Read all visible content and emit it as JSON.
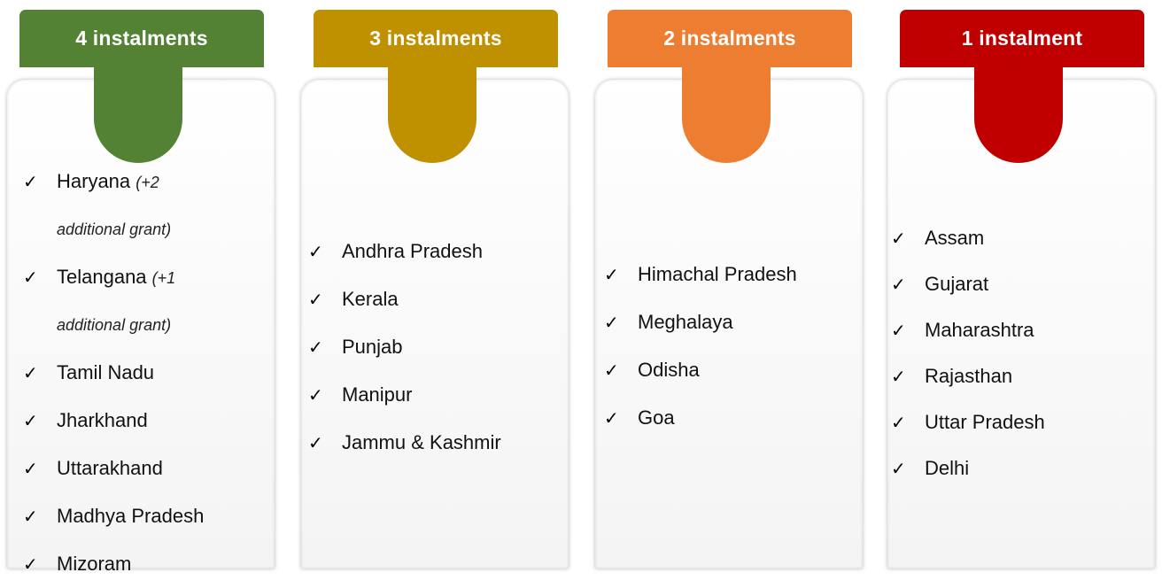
{
  "colors": {
    "green": "#548235",
    "gold": "#BF9000",
    "orange": "#ED7D31",
    "red": "#C00000"
  },
  "columns": [
    {
      "title": "4 instalments",
      "color": "#548235",
      "items": [
        {
          "label": "Haryana",
          "note_part1": "(+2",
          "note_part2": "additional grant)"
        },
        {
          "label": "Telangana",
          "note_part1": "(+1",
          "note_part2": "additional grant)"
        },
        {
          "label": "Tamil Nadu"
        },
        {
          "label": "Jharkhand"
        },
        {
          "label": "Uttarakhand"
        },
        {
          "label": "Madhya Pradesh"
        },
        {
          "label": "Mizoram"
        }
      ]
    },
    {
      "title": "3 instalments",
      "color": "#BF9000",
      "items": [
        {
          "label": "Andhra Pradesh"
        },
        {
          "label": "Kerala"
        },
        {
          "label": "Punjab"
        },
        {
          "label": "Manipur"
        },
        {
          "label": "Jammu & Kashmir"
        }
      ]
    },
    {
      "title": "2 instalments",
      "color": "#ED7D31",
      "items": [
        {
          "label": "Himachal Pradesh"
        },
        {
          "label": "Meghalaya"
        },
        {
          "label": "Odisha"
        },
        {
          "label": "Goa"
        }
      ]
    },
    {
      "title": "1 instalment",
      "color": "#C00000",
      "items": [
        {
          "label": "Assam"
        },
        {
          "label": "Gujarat"
        },
        {
          "label": "Maharashtra"
        },
        {
          "label": "Rajasthan"
        },
        {
          "label": "Uttar Pradesh"
        },
        {
          "label": "Delhi"
        }
      ]
    }
  ],
  "check_glyph": "✓"
}
